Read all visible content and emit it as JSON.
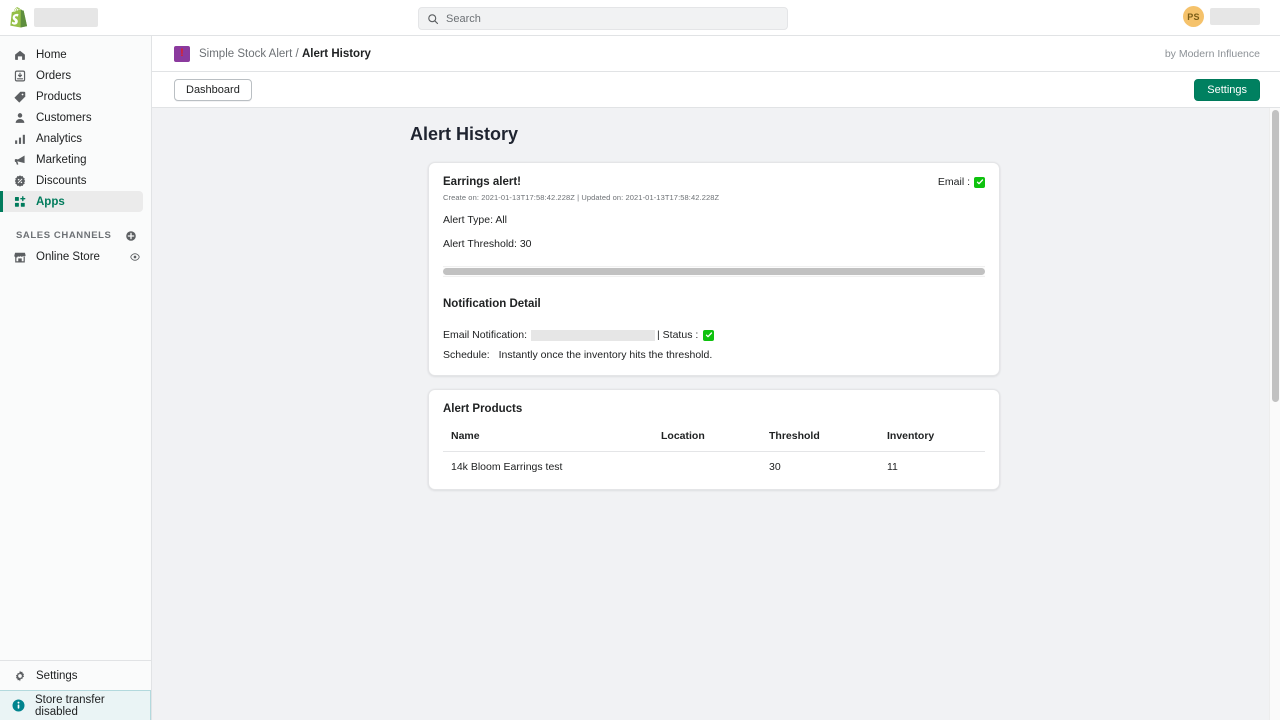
{
  "topbar": {
    "logo_icon": "shopify-logo",
    "store_name_redacted": "",
    "search": {
      "icon": "search-icon",
      "placeholder": "Search",
      "value": ""
    },
    "account": {
      "avatar_initials": "PS",
      "name_redacted": ""
    }
  },
  "sidebar": {
    "items": [
      {
        "label": "Home",
        "icon": "home-icon",
        "active": false
      },
      {
        "label": "Orders",
        "icon": "orders-icon",
        "active": false
      },
      {
        "label": "Products",
        "icon": "tag-icon",
        "active": false
      },
      {
        "label": "Customers",
        "icon": "person-icon",
        "active": false
      },
      {
        "label": "Analytics",
        "icon": "bar-chart-icon",
        "active": false
      },
      {
        "label": "Marketing",
        "icon": "megaphone-icon",
        "active": false
      },
      {
        "label": "Discounts",
        "icon": "discount-icon",
        "active": false
      },
      {
        "label": "Apps",
        "icon": "apps-icon",
        "active": true
      }
    ],
    "sales_channels": {
      "title": "SALES CHANNELS",
      "add_icon": "plus-circle-icon",
      "items": [
        {
          "label": "Online Store",
          "icon": "store-icon",
          "trailing_icon": "eye-icon"
        }
      ]
    },
    "settings": {
      "label": "Settings",
      "icon": "gear-icon"
    },
    "banner": {
      "label": "Store transfer disabled",
      "icon": "info-icon",
      "accent": "#00848e"
    }
  },
  "app_header": {
    "app_icon": "alert-app-icon",
    "app_icon_glyph": "!",
    "breadcrumb_app": "Simple Stock Alert",
    "breadcrumb_sep": "/",
    "breadcrumb_current": "Alert History",
    "byline": "by Modern Influence"
  },
  "app_toolbar": {
    "dashboard_label": "Dashboard",
    "settings_label": "Settings",
    "settings_color": "#008060"
  },
  "main": {
    "page_title": "Alert History",
    "alert_card": {
      "title": "Earrings alert!",
      "timestamps": "Create on: 2021-01-13T17:58:42.228Z | Updated on: 2021-01-13T17:58:42.228Z",
      "email_flag_label": "Email :",
      "email_flag_icon": "green-check-icon",
      "alert_type": "Alert Type: All",
      "alert_threshold": "Alert Threshold: 30",
      "notification_detail_title": "Notification Detail",
      "email_notification_label": "Email Notification:",
      "email_notification_value_redacted": "",
      "status_label": "| Status :",
      "status_icon": "green-check-icon",
      "schedule_label": "Schedule:",
      "schedule_value": "Instantly once the inventory hits the threshold."
    },
    "products_card": {
      "title": "Alert Products",
      "columns": [
        "Name",
        "Location",
        "Threshold",
        "Inventory"
      ],
      "rows": [
        {
          "name": "14k Bloom Earrings test",
          "location": "",
          "threshold": "30",
          "inventory": "11"
        }
      ]
    }
  }
}
